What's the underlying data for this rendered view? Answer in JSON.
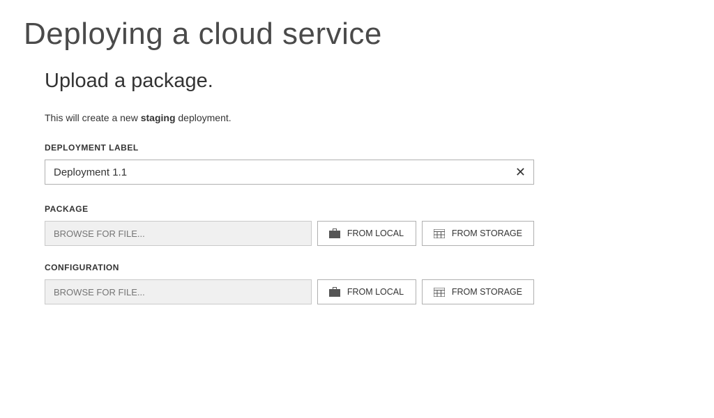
{
  "page": {
    "title": "Deploying a cloud service"
  },
  "upload": {
    "heading": "Upload a package.",
    "description_prefix": "This will create a new ",
    "description_bold": "staging",
    "description_suffix": " deployment."
  },
  "deployment_label": {
    "label": "DEPLOYMENT LABEL",
    "value": "Deployment 1.1",
    "clear_glyph": "✕"
  },
  "package": {
    "label": "PACKAGE",
    "browse_placeholder": "BROWSE FOR FILE...",
    "from_local": "FROM LOCAL",
    "from_storage": "FROM STORAGE"
  },
  "configuration": {
    "label": "CONFIGURATION",
    "browse_placeholder": "BROWSE FOR FILE...",
    "from_local": "FROM LOCAL",
    "from_storage": "FROM STORAGE"
  }
}
